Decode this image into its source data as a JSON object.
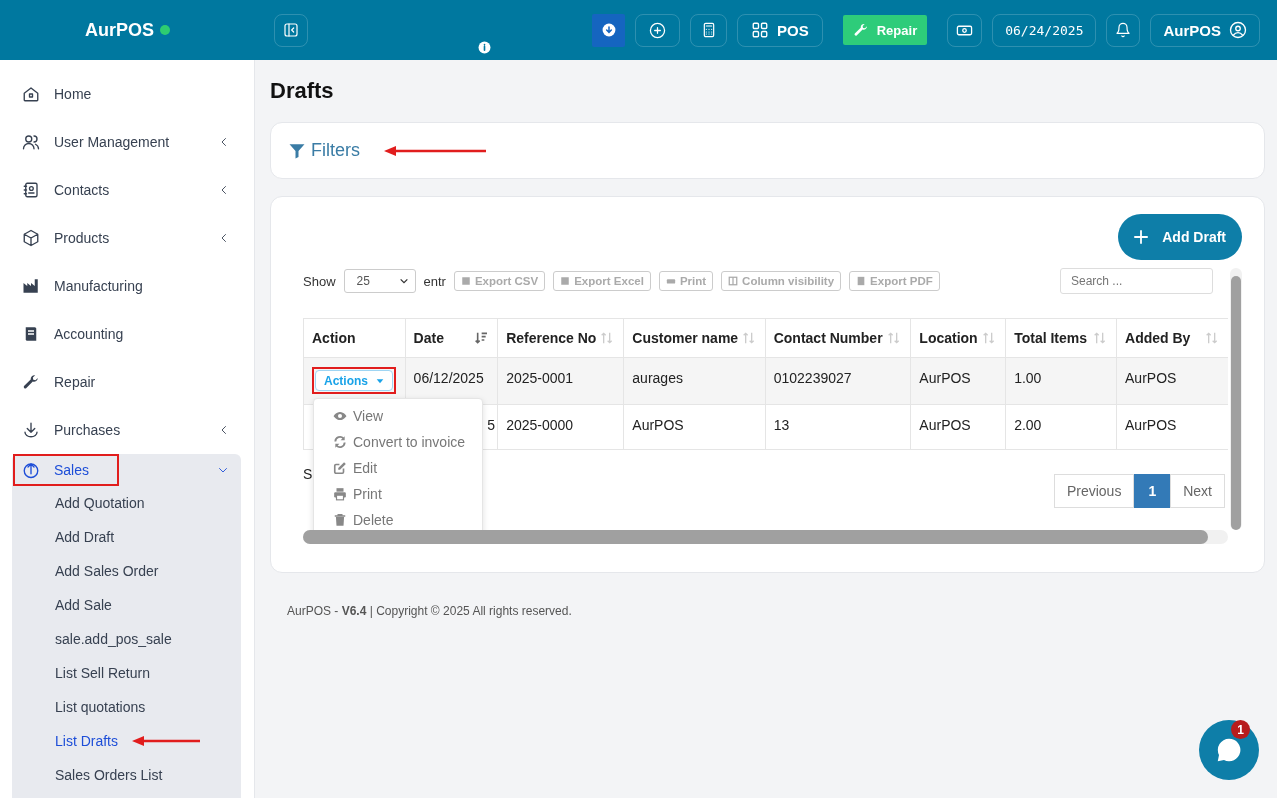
{
  "brand": {
    "name": "AurPOS"
  },
  "topbar": {
    "pos_label": "POS",
    "repair_label": "Repair",
    "date": "06/24/2025",
    "user": "AurPOS"
  },
  "sidebar": {
    "items": [
      {
        "label": "Home",
        "kind": "link",
        "selected": false
      },
      {
        "label": "User Management",
        "kind": "group",
        "expanded": false,
        "selected": false
      },
      {
        "label": "Contacts",
        "kind": "group",
        "expanded": false,
        "selected": false
      },
      {
        "label": "Products",
        "kind": "group",
        "expanded": false,
        "selected": false
      },
      {
        "label": "Manufacturing",
        "kind": "link",
        "selected": false
      },
      {
        "label": "Accounting",
        "kind": "link",
        "selected": false
      },
      {
        "label": "Repair",
        "kind": "link",
        "selected": false
      },
      {
        "label": "Purchases",
        "kind": "group",
        "expanded": false,
        "selected": false
      },
      {
        "label": "Sales",
        "kind": "group",
        "expanded": true,
        "selected": true,
        "children": [
          {
            "label": "Add Quotation",
            "selected": false
          },
          {
            "label": "Add Draft",
            "selected": false
          },
          {
            "label": "Add Sales Order",
            "selected": false
          },
          {
            "label": "Add Sale",
            "selected": false
          },
          {
            "label": "sale.add_pos_sale",
            "selected": false
          },
          {
            "label": "List Sell Return",
            "selected": false
          },
          {
            "label": "List quotations",
            "selected": false
          },
          {
            "label": "List Drafts",
            "selected": true
          },
          {
            "label": "Sales Orders List",
            "selected": false
          }
        ]
      }
    ]
  },
  "page": {
    "title": "Drafts",
    "filters_label": "Filters",
    "add_button": "Add Draft",
    "show_label": "Show",
    "page_length": "25",
    "entries_label": "entr",
    "export_buttons": [
      "Export CSV",
      "Export Excel",
      "Print",
      "Column visibility",
      "Export PDF"
    ],
    "search": {
      "placeholder": "Search ..."
    },
    "table": {
      "columns": [
        {
          "label": "Action",
          "sortable": false
        },
        {
          "label": "Date",
          "sortable": true,
          "sorted": true
        },
        {
          "label": "Reference No",
          "sortable": true,
          "sorted": false
        },
        {
          "label": "Customer name",
          "sortable": true,
          "sorted": false
        },
        {
          "label": "Contact Number",
          "sortable": true,
          "sorted": false
        },
        {
          "label": "Location",
          "sortable": true,
          "sorted": false
        },
        {
          "label": "Total Items",
          "sortable": true,
          "sorted": false
        },
        {
          "label": "Added By",
          "sortable": true,
          "sorted": false
        }
      ],
      "rows": [
        {
          "action": "Actions",
          "date": "06/12/2025",
          "reference": "2025-0001",
          "customer": "aurages",
          "contact": "0102239027",
          "location": "AurPOS",
          "total_items": "1.00",
          "added_by": "AurPOS"
        },
        {
          "date": "5",
          "reference": "2025-0000",
          "customer": "AurPOS",
          "contact": "13",
          "location": "AurPOS",
          "total_items": "2.00",
          "added_by": "AurPOS"
        }
      ]
    },
    "actions_menu": [
      "View",
      "Convert to invoice",
      "Edit",
      "Print",
      "Delete"
    ],
    "info_text": "S",
    "pagination": {
      "previous": "Previous",
      "pages": [
        {
          "label": "1",
          "selected": true
        }
      ],
      "next": "Next"
    }
  },
  "footer": "AurPOS - **V6.4** | Copyright © 2025 All rights reserved.",
  "chat": {
    "badge": "1"
  }
}
